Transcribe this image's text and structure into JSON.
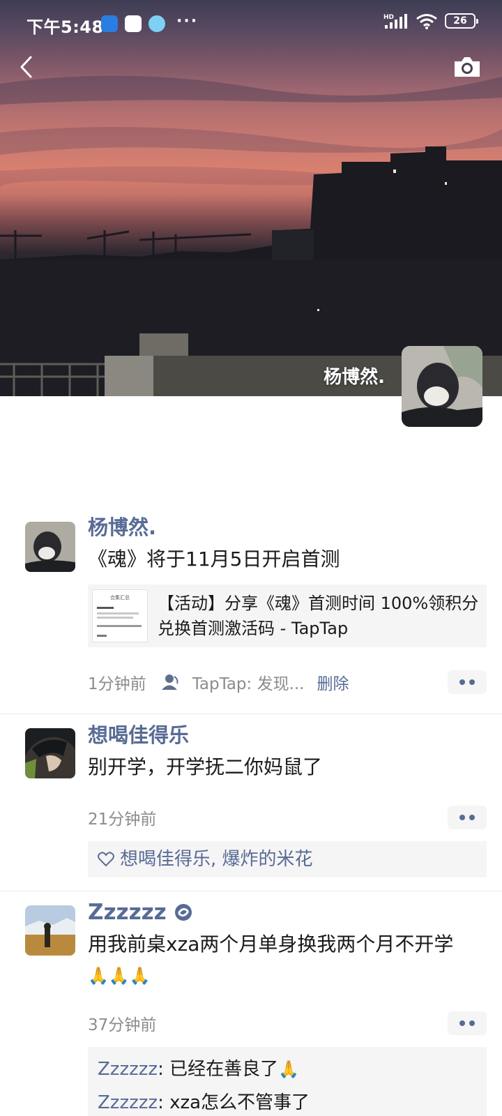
{
  "status_bar": {
    "time": "下午5:48",
    "more_indicator": "···",
    "network_label": "HD",
    "battery": "26"
  },
  "cover": {
    "user_name": "杨博然."
  },
  "posts": [
    {
      "author": "杨博然.",
      "text": "《魂》将于11月5日开启首测",
      "link_title": "【活动】分享《魂》首测时间 100%领积分兑换首测激活码 - TapTap",
      "link_thumb_title": "合集汇总",
      "time": "1分钟前",
      "source": "TapTap: 发现...",
      "delete_label": "删除"
    },
    {
      "author": "想喝佳得乐",
      "text": "别开学，开学抚二你妈鼠了",
      "time": "21分钟前",
      "likes": "想喝佳得乐, 爆炸的米花"
    },
    {
      "author": "Zzzzzz",
      "text": "用我前桌xza两个月单身换我两个月不开学",
      "text_emoji": "🙏🙏🙏",
      "time": "37分钟前",
      "comments": [
        {
          "name": "Zzzzzz",
          "sep": ": ",
          "text": "已经在善良了",
          "emoji": "🙏"
        },
        {
          "name": "Zzzzzz",
          "sep": ": ",
          "text": "xza怎么不管事了",
          "emoji": ""
        }
      ]
    }
  ],
  "icons": {
    "back": "chevron-left-icon",
    "camera": "camera-icon",
    "privacy": "person-icon",
    "like": "heart-icon",
    "verified": "badge-icon"
  },
  "colors": {
    "link_blue": "#576b95",
    "meta_gray": "#8c8c8c",
    "card_bg": "#f5f5f5"
  }
}
